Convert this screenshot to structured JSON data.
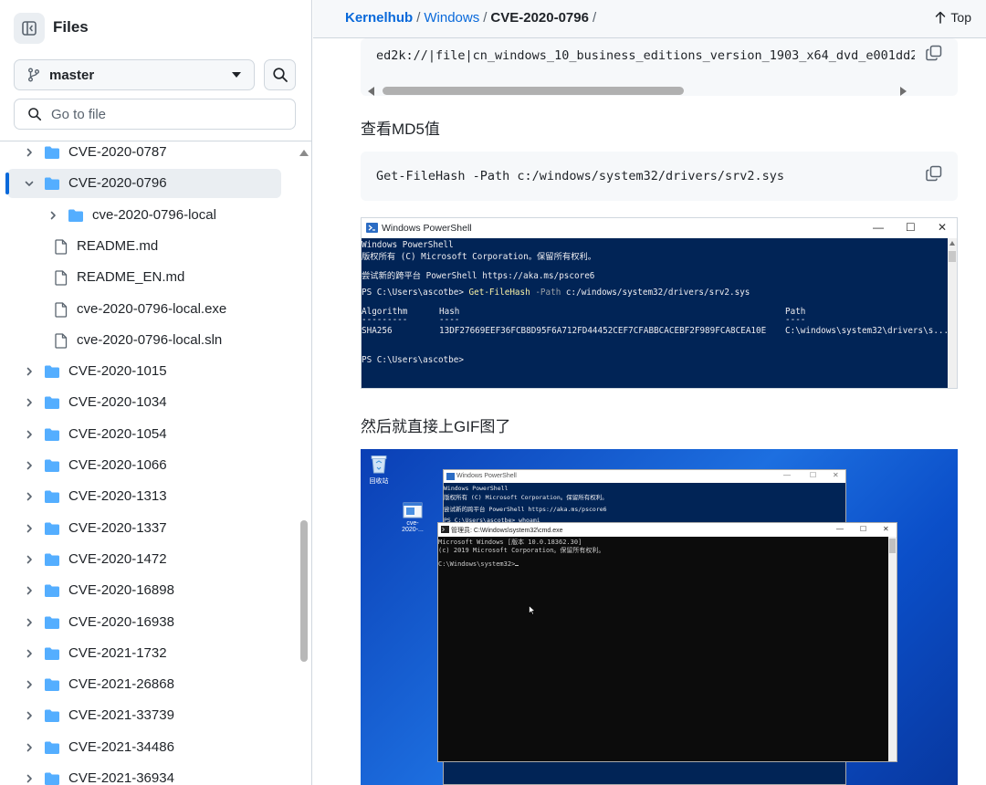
{
  "sidebar": {
    "title": "Files",
    "branch": "master",
    "goto_placeholder": "Go to file",
    "tree": [
      {
        "label": "CVE-2020-0787",
        "type": "folder",
        "expanded": false,
        "level": 0
      },
      {
        "label": "CVE-2020-0796",
        "type": "folder",
        "expanded": true,
        "level": 0,
        "selected": true
      },
      {
        "label": "cve-2020-0796-local",
        "type": "folder",
        "expanded": false,
        "level": 1
      },
      {
        "label": "README.md",
        "type": "file",
        "level": 1
      },
      {
        "label": "README_EN.md",
        "type": "file",
        "level": 1
      },
      {
        "label": "cve-2020-0796-local.exe",
        "type": "file",
        "level": 1
      },
      {
        "label": "cve-2020-0796-local.sln",
        "type": "file",
        "level": 1
      },
      {
        "label": "CVE-2020-1015",
        "type": "folder",
        "expanded": false,
        "level": 0
      },
      {
        "label": "CVE-2020-1034",
        "type": "folder",
        "expanded": false,
        "level": 0
      },
      {
        "label": "CVE-2020-1054",
        "type": "folder",
        "expanded": false,
        "level": 0
      },
      {
        "label": "CVE-2020-1066",
        "type": "folder",
        "expanded": false,
        "level": 0
      },
      {
        "label": "CVE-2020-1313",
        "type": "folder",
        "expanded": false,
        "level": 0
      },
      {
        "label": "CVE-2020-1337",
        "type": "folder",
        "expanded": false,
        "level": 0
      },
      {
        "label": "CVE-2020-1472",
        "type": "folder",
        "expanded": false,
        "level": 0
      },
      {
        "label": "CVE-2020-16898",
        "type": "folder",
        "expanded": false,
        "level": 0
      },
      {
        "label": "CVE-2020-16938",
        "type": "folder",
        "expanded": false,
        "level": 0
      },
      {
        "label": "CVE-2021-1732",
        "type": "folder",
        "expanded": false,
        "level": 0
      },
      {
        "label": "CVE-2021-26868",
        "type": "folder",
        "expanded": false,
        "level": 0
      },
      {
        "label": "CVE-2021-33739",
        "type": "folder",
        "expanded": false,
        "level": 0
      },
      {
        "label": "CVE-2021-34486",
        "type": "folder",
        "expanded": false,
        "level": 0
      },
      {
        "label": "CVE-2021-36934",
        "type": "folder",
        "expanded": false,
        "level": 0
      }
    ]
  },
  "breadcrumb": {
    "repo": "Kernelhub",
    "sep1": "/",
    "folder": "Windows",
    "sep2": "/",
    "current": "CVE-2020-0796",
    "sep3": "/"
  },
  "top_button": "Top",
  "content": {
    "code1": "ed2k://|file|cn_windows_10_business_editions_version_1903_x64_dvd_e001dd2c",
    "heading1": "查看MD5值",
    "code2": "Get-FileHash -Path c:/windows/system32/drivers/srv2.sys",
    "powershell": {
      "title": "Windows PowerShell",
      "line1": "Windows PowerShell",
      "line2": "版权所有 (C) Microsoft Corporation。保留所有权利。",
      "line3": "尝试新的跨平台 PowerShell https://aka.ms/pscore6",
      "prompt1": "PS C:\\Users\\ascotbe> ",
      "cmd_name": "Get-FileHash",
      "cmd_param": " -Path ",
      "cmd_arg": "c:/windows/system32/drivers/srv2.sys",
      "col_algorithm": "Algorithm",
      "col_hash": "Hash",
      "col_path": "Path",
      "sep_algorithm": "---------",
      "sep_hash": "----",
      "sep_path": "----",
      "row_algorithm": "SHA256",
      "row_hash": "13DF27669EEF36FCB8D95F6A712FD44452CEF7CFABBCACEBF2F989FCA8CEA10E",
      "row_path": "C:\\windows\\system32\\drivers\\s...",
      "prompt2": "PS C:\\Users\\ascotbe>"
    },
    "heading2": "然后就直接上GIF图了",
    "desktop": {
      "icon1_label": "回收站",
      "icon2_label": "cve-2020-...",
      "ps_title": "Windows PowerShell",
      "ps_line1": "Windows PowerShell",
      "ps_line2": "版权所有 (C) Microsoft Corporation。保留所有权利。",
      "ps_line3": "尝试新的跨平台 PowerShell https://aka.ms/pscore6",
      "ps_line4": "PS C:\\Users\\ascotbe> whoami",
      "cmd_title": "管理员: C:\\Windows\\system32\\cmd.exe",
      "cmd_line1": "Microsoft Windows [版本 10.0.18362.30]",
      "cmd_line2": "(c) 2019 Microsoft Corporation。保留所有权利。",
      "cmd_line3": "C:\\Windows\\system32>"
    }
  },
  "colors": {
    "accent": "#0969da",
    "folder": "#54aeff",
    "ps_background": "#012456",
    "cmd_background": "#0c0c0c",
    "desktop_blue": "#1d6fe0"
  }
}
